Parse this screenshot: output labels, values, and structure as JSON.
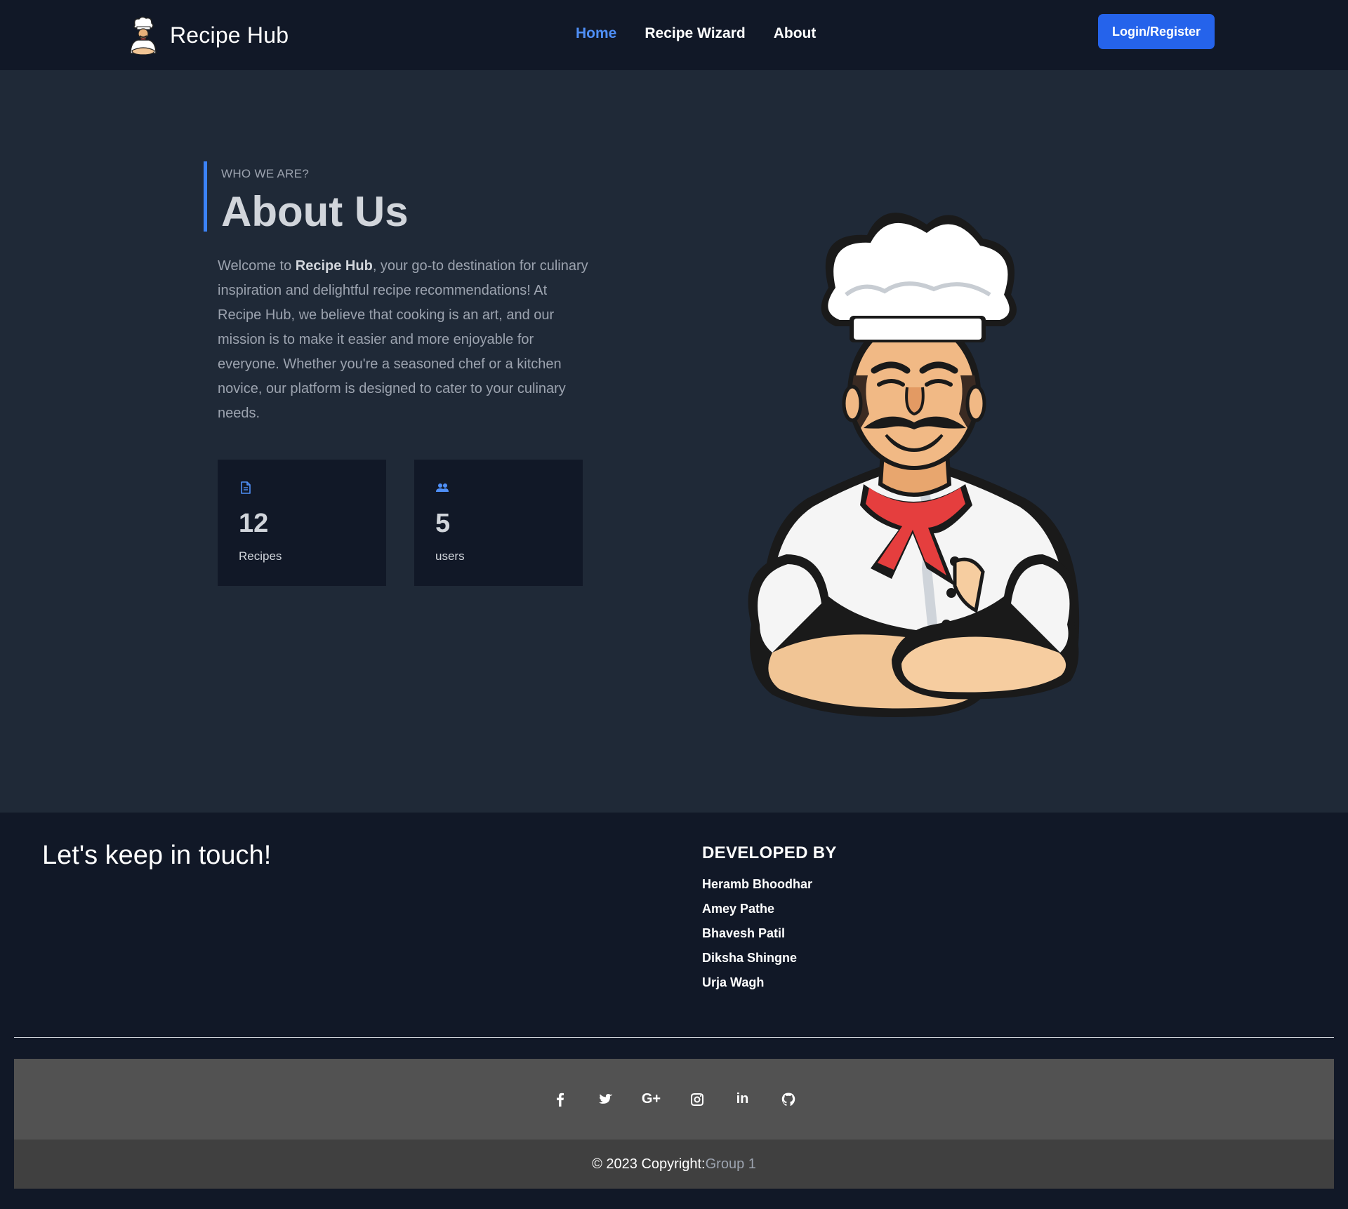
{
  "navbar": {
    "brand_name": "Recipe Hub",
    "links": [
      {
        "label": "Home",
        "active": true
      },
      {
        "label": "Recipe Wizard",
        "active": false
      },
      {
        "label": "About",
        "active": false
      }
    ],
    "login_label": "Login/Register"
  },
  "about": {
    "eyebrow": "WHO WE ARE?",
    "title": "About Us",
    "para_prefix": "Welcome to ",
    "para_brand": "Recipe Hub",
    "para_rest": ", your go-to destination for culinary inspiration and delightful recipe recommendations! At Recipe Hub, we believe that cooking is an art, and our mission is to make it easier and more enjoyable for everyone. Whether you're a seasoned chef or a kitchen novice, our platform is designed to cater to your culinary needs.",
    "stats": [
      {
        "icon": "document-icon",
        "value": "12",
        "label": "Recipes"
      },
      {
        "icon": "users-icon",
        "value": "5",
        "label": "users"
      }
    ]
  },
  "footer": {
    "keep_in_touch": "Let's keep in touch!",
    "developed_by": "DEVELOPED BY",
    "developers": [
      "Heramb Bhoodhar",
      "Amey Pathe",
      "Bhavesh Patil",
      "Diksha Shingne",
      "Urja Wagh"
    ],
    "social": [
      {
        "name": "facebook-icon"
      },
      {
        "name": "twitter-icon"
      },
      {
        "name": "google-plus-icon",
        "text": "G+"
      },
      {
        "name": "instagram-icon"
      },
      {
        "name": "linkedin-icon",
        "text": "in"
      },
      {
        "name": "github-icon"
      }
    ],
    "copyright_prefix": "© 2023 Copyright:",
    "copyright_group": "Group 1"
  },
  "colors": {
    "accent": "#3b82f6",
    "link_active": "#4f8ff7",
    "button": "#2563eb",
    "nav_bg": "#111827",
    "hero_bg": "#1f2937"
  }
}
